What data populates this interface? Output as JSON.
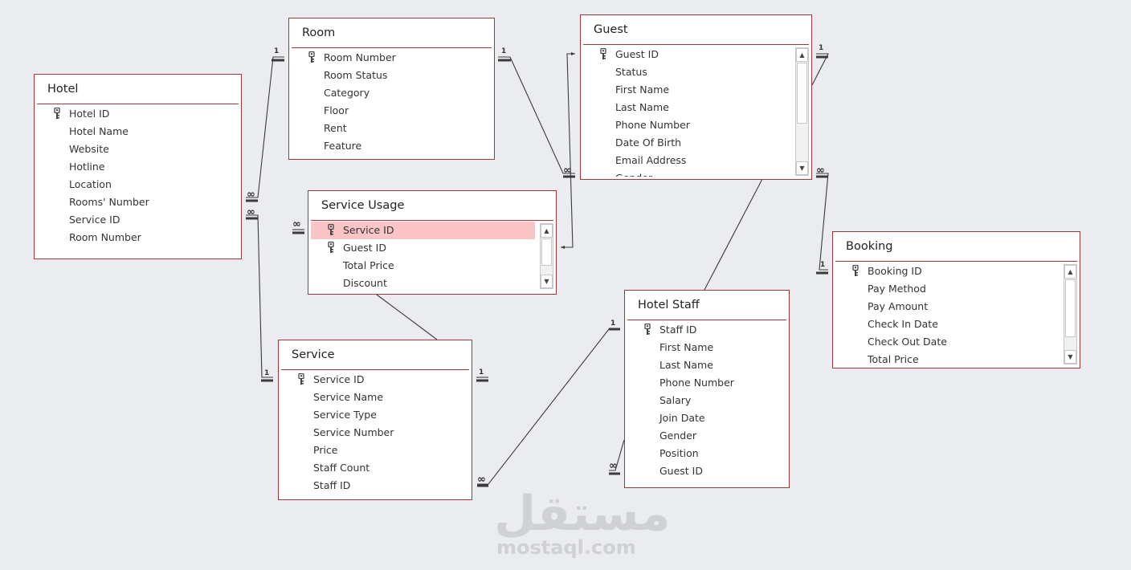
{
  "tables": {
    "hotel": {
      "title": "Hotel",
      "fields": [
        {
          "name": "Hotel ID",
          "key": true
        },
        {
          "name": "Hotel Name"
        },
        {
          "name": "Website"
        },
        {
          "name": "Hotline"
        },
        {
          "name": "Location"
        },
        {
          "name": "Rooms' Number"
        },
        {
          "name": "Service ID"
        },
        {
          "name": "Room Number"
        }
      ]
    },
    "room": {
      "title": "Room",
      "fields": [
        {
          "name": "Room Number",
          "key": true
        },
        {
          "name": "Room Status"
        },
        {
          "name": "Category"
        },
        {
          "name": "Floor"
        },
        {
          "name": "Rent"
        },
        {
          "name": "Feature"
        }
      ]
    },
    "guest": {
      "title": "Guest",
      "fields": [
        {
          "name": "Guest ID",
          "key": true
        },
        {
          "name": "Status"
        },
        {
          "name": "First Name"
        },
        {
          "name": "Last Name"
        },
        {
          "name": "Phone Number"
        },
        {
          "name": "Date Of Birth"
        },
        {
          "name": "Email Address"
        },
        {
          "name": "Gender"
        }
      ]
    },
    "service_usage": {
      "title": "Service Usage",
      "fields": [
        {
          "name": "Service ID",
          "key": true,
          "selected": true
        },
        {
          "name": "Guest ID",
          "key": true
        },
        {
          "name": "Total Price"
        },
        {
          "name": "Discount"
        }
      ]
    },
    "booking": {
      "title": "Booking",
      "fields": [
        {
          "name": "Booking ID",
          "key": true
        },
        {
          "name": "Pay Method"
        },
        {
          "name": "Pay Amount"
        },
        {
          "name": "Check In Date"
        },
        {
          "name": "Check Out Date"
        },
        {
          "name": "Total Price"
        }
      ]
    },
    "hotel_staff": {
      "title": "Hotel Staff",
      "fields": [
        {
          "name": "Staff ID",
          "key": true
        },
        {
          "name": "First Name"
        },
        {
          "name": "Last Name"
        },
        {
          "name": "Phone Number"
        },
        {
          "name": "Salary"
        },
        {
          "name": "Join Date"
        },
        {
          "name": "Gender"
        },
        {
          "name": "Position"
        },
        {
          "name": "Guest ID"
        }
      ]
    },
    "service": {
      "title": "Service",
      "fields": [
        {
          "name": "Service ID",
          "key": true
        },
        {
          "name": "Service Name"
        },
        {
          "name": "Service Type"
        },
        {
          "name": "Service Number"
        },
        {
          "name": "Price"
        },
        {
          "name": "Staff Count"
        },
        {
          "name": "Staff ID"
        }
      ]
    }
  },
  "cardinality": {
    "one": "1",
    "many": "∞"
  },
  "watermark": {
    "arabic": "مستقل",
    "latin": "mostaql.com"
  },
  "colors": {
    "border": "#a4373a",
    "selected_row": "#fbc4c6",
    "background": "#eaecef"
  }
}
